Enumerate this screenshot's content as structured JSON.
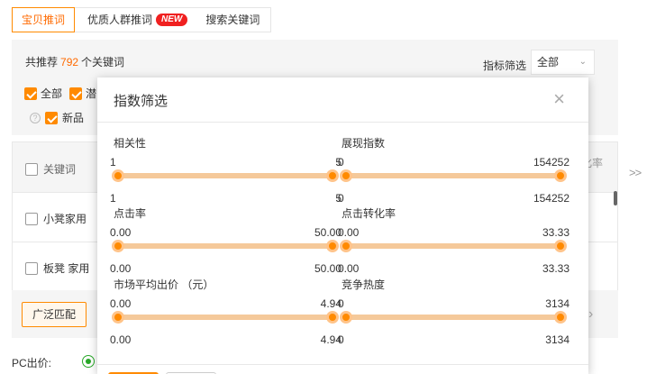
{
  "tabs": [
    {
      "label": "宝贝推词"
    },
    {
      "label": "优质人群推词",
      "badge": "NEW"
    },
    {
      "label": "搜索关键词"
    }
  ],
  "summary": {
    "prefix": "共推荐",
    "count": "792",
    "suffix": "个关键词"
  },
  "metric_filter": {
    "label": "指标筛选",
    "value": "全部"
  },
  "options": {
    "all": "全部",
    "second": "潜",
    "new": "新品"
  },
  "table": {
    "header_keyword": "关键词",
    "header_rate_partial": "化率",
    "rows": [
      {
        "keyword": "小凳家用"
      },
      {
        "keyword": "板凳 家用"
      }
    ]
  },
  "broad_match_button": "广泛匹配",
  "pc_price_label": "PC出价:",
  "modal": {
    "title": "指数筛选",
    "controls": [
      {
        "label": "相关性",
        "min": "1",
        "max": "5",
        "low": "1",
        "high": "5"
      },
      {
        "label": "展现指数",
        "min": "0",
        "max": "154252",
        "low": "0",
        "high": "154252"
      },
      {
        "label": "点击率",
        "min": "0.00",
        "max": "50.00",
        "low": "0.00",
        "high": "50.00"
      },
      {
        "label": "点击转化率",
        "min": "0.00",
        "max": "33.33",
        "low": "0.00",
        "high": "33.33"
      },
      {
        "label": "市场平均出价 （元）",
        "min": "0.00",
        "max": "4.94",
        "low": "0.00",
        "high": "4.94"
      },
      {
        "label": "竞争热度",
        "min": "0",
        "max": "3134",
        "low": "0",
        "high": "3134"
      }
    ]
  },
  "colors": {
    "accent": "#ff8a00",
    "track": "#f5c99a",
    "new_badge": "#f02020",
    "radio": "#29a829"
  }
}
